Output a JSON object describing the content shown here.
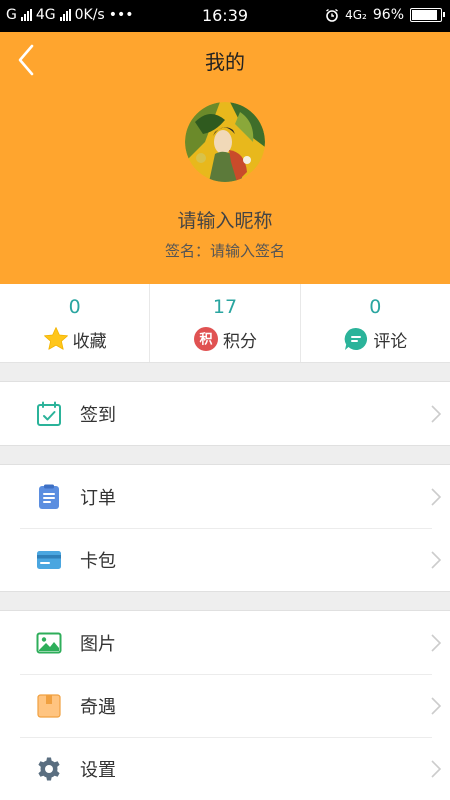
{
  "status_bar": {
    "carrier_left": "G",
    "carrier_4g": "4G",
    "speed": "0K/s",
    "dots": "•••",
    "time": "16:39",
    "network": "4G₂",
    "battery": "96%",
    "battery_level": 0.96
  },
  "header": {
    "title": "我的",
    "nickname": "请输入昵称",
    "signature": "签名：请输入签名",
    "background_color": "#ffa52e"
  },
  "stats": [
    {
      "value": "0",
      "label": "收藏",
      "icon": "star-icon"
    },
    {
      "value": "17",
      "label": "积分",
      "icon": "points-icon",
      "icon_text": "积"
    },
    {
      "value": "0",
      "label": "评论",
      "icon": "comment-icon"
    }
  ],
  "menu": {
    "checkin": {
      "label": "签到",
      "icon": "calendar-check-icon"
    },
    "orders": {
      "label": "订单",
      "icon": "order-list-icon"
    },
    "cards": {
      "label": "卡包",
      "icon": "card-icon"
    },
    "pictures": {
      "label": "图片",
      "icon": "image-icon"
    },
    "encounter": {
      "label": "奇遇",
      "icon": "box-icon"
    },
    "settings": {
      "label": "设置",
      "icon": "gear-icon"
    }
  },
  "colors": {
    "accent": "#ffa52e",
    "stat_number": "#2aa5a0"
  }
}
